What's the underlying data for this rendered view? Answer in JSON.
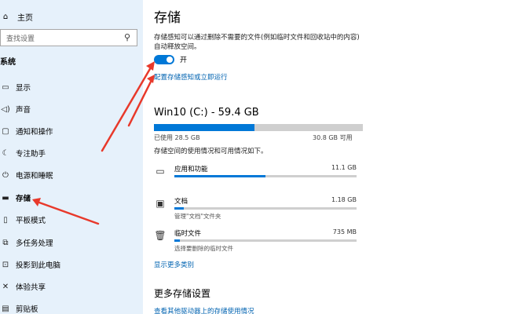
{
  "sidebar": {
    "home_icon": "home-icon",
    "home_label": "主页",
    "search_placeholder": "查找设置",
    "section_label": "系统",
    "items": [
      {
        "icon": "display-icon",
        "label": "显示"
      },
      {
        "icon": "sound-icon",
        "label": "声音"
      },
      {
        "icon": "notification-icon",
        "label": "通知和操作"
      },
      {
        "icon": "focus-assist-icon",
        "label": "专注助手"
      },
      {
        "icon": "power-icon",
        "label": "电源和睡眠"
      },
      {
        "icon": "storage-icon",
        "label": "存储"
      },
      {
        "icon": "tablet-icon",
        "label": "平板模式"
      },
      {
        "icon": "multitasking-icon",
        "label": "多任务处理"
      },
      {
        "icon": "projecting-icon",
        "label": "投影到此电脑"
      },
      {
        "icon": "shared-experience-icon",
        "label": "体验共享"
      },
      {
        "icon": "clipboard-icon",
        "label": "剪贴板"
      }
    ]
  },
  "main": {
    "title": "存储",
    "sense_description": "存储感知可以通过删除不需要的文件(例如临时文件和回收站中的内容)自动释放空间。",
    "toggle_state_label": "开",
    "toggle_on": true,
    "configure_link": "配置存储感知或立即运行",
    "drive": {
      "title": "Win10 (C:) - 59.4 GB",
      "used_label": "已使用 28.5 GB",
      "total_label": "30.8 GB 可用",
      "used_fraction": 0.48
    },
    "usage_description": "存储空间的使用情况和可用情况如下。",
    "categories": [
      {
        "icon": "apps-icon",
        "name": "应用和功能",
        "size": "11.1 GB",
        "sub": "",
        "fraction": 0.5
      },
      {
        "icon": "documents-icon",
        "name": "文档",
        "size": "1.18 GB",
        "sub": "管理\"文档\"文件夹",
        "fraction": 0.05
      },
      {
        "icon": "temp-files-icon",
        "name": "临时文件",
        "size": "735 MB",
        "sub": "选择要删除的临时文件",
        "fraction": 0.03
      }
    ],
    "show_more": "显示更多类别",
    "more_settings_title": "更多存储设置",
    "more_settings_link": "查看其他驱动器上的存储使用情况"
  },
  "colors": {
    "accent": "#0078d7",
    "link": "#0063b1",
    "sidebar_bg": "#e6f1fb",
    "annotation_arrow": "#e8392b"
  }
}
